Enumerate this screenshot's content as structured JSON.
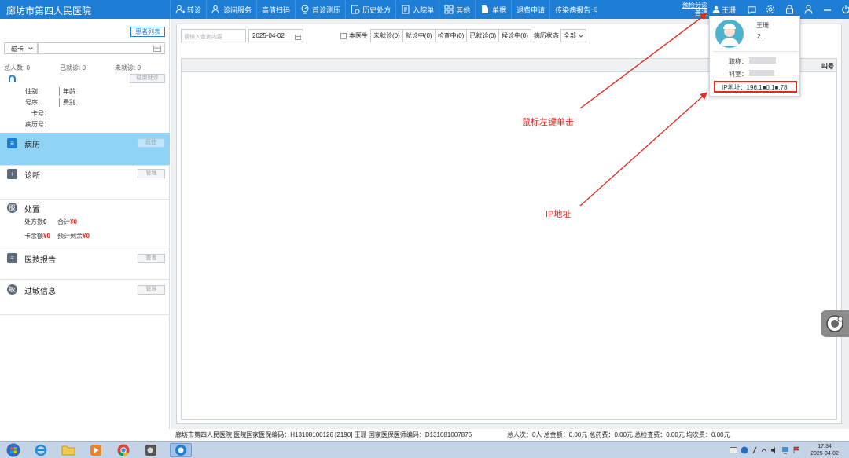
{
  "app": {
    "title": "廊坊市第四人民医院"
  },
  "nav": [
    {
      "label": "转诊",
      "icon": "person-transfer-icon"
    },
    {
      "label": "诊间服务",
      "icon": "person-service-icon"
    },
    {
      "label": "高值扫码",
      "icon": ""
    },
    {
      "label": "首诊测压",
      "icon": "blood-pressure-icon"
    },
    {
      "label": "历史处方",
      "icon": "history-prescription-icon"
    },
    {
      "label": "入院单",
      "icon": "admission-form-icon"
    },
    {
      "label": "其他",
      "icon": "grid-icon"
    },
    {
      "label": "单据",
      "icon": "document-icon"
    },
    {
      "label": "退费申请",
      "icon": ""
    },
    {
      "label": "传染病报告卡",
      "icon": ""
    }
  ],
  "header": {
    "link1": "预检分诊",
    "link2": "普通",
    "user_name": "王珊"
  },
  "sidebar": {
    "patient_list_button": "患者列表",
    "card_type": "磁卡",
    "stats": {
      "total": "总人数: 0",
      "seen": "已就诊: 0",
      "unseen": "未就诊: 0"
    },
    "end_button": "结束就诊",
    "patient_fields": {
      "gender": "性别：",
      "age": "年龄：",
      "queue": "号序：",
      "fee_type": "费别：",
      "card_no": "卡号：",
      "record_no": "病历号："
    },
    "sections": [
      {
        "title": "病历",
        "button": "既往",
        "icon_char": "≡"
      },
      {
        "title": "诊断",
        "button": "管理",
        "icon_char": "+"
      },
      {
        "title": "处置",
        "button": "",
        "icon_char": "服"
      },
      {
        "title": "医技报告",
        "button": "查看",
        "icon_char": "≡"
      },
      {
        "title": "过敏信息",
        "button": "管理",
        "icon_char": "敏"
      }
    ],
    "disposal": {
      "rx_count_label": "处方数",
      "rx_count": "0",
      "total_label": "合计",
      "total": "¥0",
      "balance_label": "卡余额",
      "balance": "¥0",
      "remaining_label": "预计剩余",
      "remaining": "¥0"
    }
  },
  "main": {
    "search_placeholder": "请输入查询内容",
    "date": "2025-04-02",
    "filters": [
      "本医生",
      "未就诊(0)",
      "就诊中(0)",
      "检查中(0)",
      "已就诊(0)",
      "候诊中(0)",
      "病历状态"
    ],
    "status_select": "全部",
    "grid_right_header": "叫号"
  },
  "popup": {
    "name": "王珊",
    "id": "2...",
    "title_label": "职称：",
    "dept_label": "科室：",
    "ip": "IP地址：196.1■0.1■.78"
  },
  "annotations": {
    "click": "鼠标左键单击",
    "ip": "IP地址"
  },
  "statusbar": {
    "left": "廊坊市第四人民医院  医院国家医保编码：H13108100126 [2190] 王珊 国家医保医师编码：D131081007876",
    "right": "总人次：0人  总金额：0.00元  总药费：0.00元  总检查费：0.00元  均次费：0.00元"
  },
  "taskbar": {
    "time": "17:34",
    "date": "2025-04-02"
  },
  "colors": {
    "brand": "#1e7ed6",
    "highlight": "#8fd3f7",
    "annotation": "#e02b1f"
  }
}
